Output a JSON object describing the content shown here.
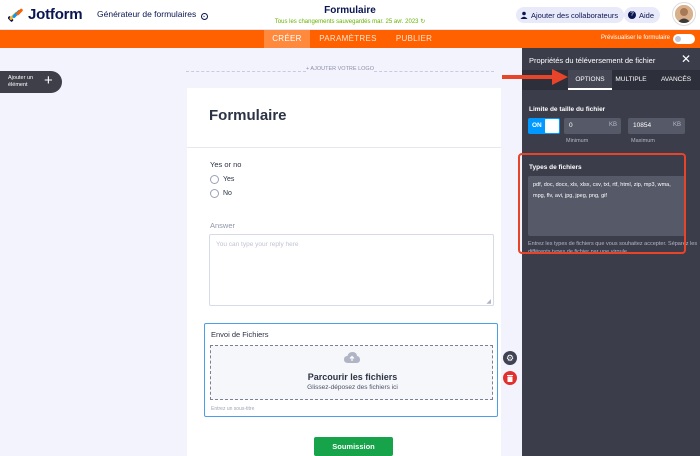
{
  "app": {
    "logo_text": "Jotform",
    "builder_label": "Générateur de formulaires",
    "form_title": "Formulaire",
    "saved_status": "Tous les changements sauvegardés mar. 25 avr. 2023",
    "collab_button": "Ajouter des collaborateurs",
    "help_button": "Aide",
    "brand_color": "#ff6100"
  },
  "nav": {
    "tabs": [
      {
        "label": "CRÉER",
        "active": true
      },
      {
        "label": "PARAMÈTRES",
        "active": false
      },
      {
        "label": "PUBLIER",
        "active": false
      }
    ],
    "preview_label": "Prévisualiser le formulaire"
  },
  "sidebar": {
    "add_element_line1": "Ajouter un",
    "add_element_line2": "élément"
  },
  "form": {
    "add_logo": "+ AJOUTER VOTRE LOGO",
    "heading": "Formulaire",
    "question": "Yes or no",
    "options": [
      "Yes",
      "No"
    ],
    "answer_label": "Answer",
    "answer_placeholder": "You can type your reply here",
    "upload_title": "Envoi de Fichiers",
    "upload_main": "Parcourir les fichiers",
    "upload_sub": "Glissez-déposez des fichiers ici",
    "subtitle_hint": "Entrez un sous-titre",
    "submit": "Soumission"
  },
  "panel": {
    "title": "Propriétés du téléversement de fichier",
    "tabs": [
      {
        "label": "OPTIONS",
        "active": true
      },
      {
        "label": "MULTIPLE",
        "active": false
      },
      {
        "label": "AVANCÉS",
        "active": false
      }
    ],
    "size_limit_label": "Limite de taille du fichier",
    "toggle_label": "ON",
    "min_value": "0",
    "max_value": "10854",
    "unit": "KB",
    "min_caption": "Minimum",
    "max_caption": "Maximum",
    "types_label": "Types de fichiers",
    "types_value": "pdf, doc, docx, xls, xlsx, csv, txt, rtf, html, zip, mp3, wma, mpg, flv, avi, jpg, jpeg, png, gif",
    "types_help": "Entrez les types de fichiers que vous souhaitez accepter. Séparez les différents types de fichier par une virgule."
  }
}
